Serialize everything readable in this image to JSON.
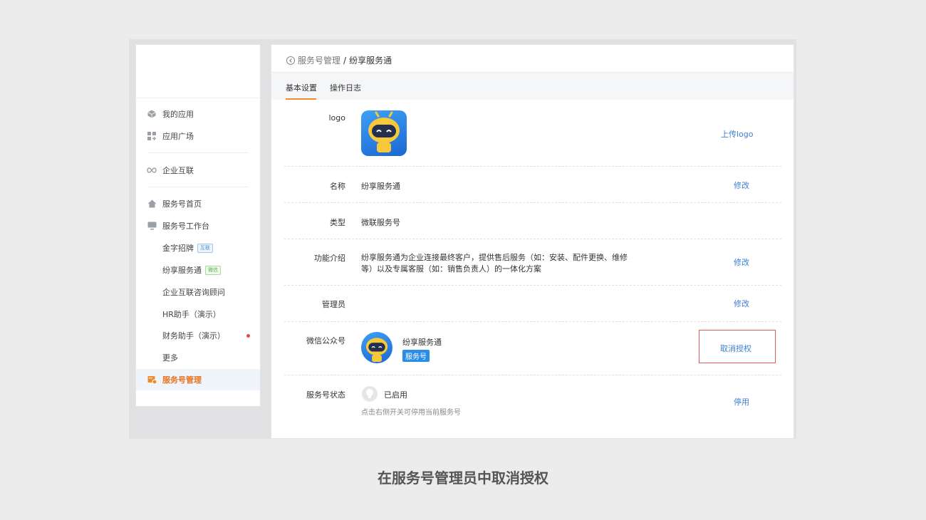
{
  "sidebar": {
    "items": [
      {
        "label": "我的应用",
        "icon": "cube-icon"
      },
      {
        "label": "应用广场",
        "icon": "apps-plus-icon"
      },
      {
        "label": "企业互联",
        "icon": "infinity-icon"
      },
      {
        "label": "服务号首页",
        "icon": "home-icon"
      },
      {
        "label": "服务号工作台",
        "icon": "monitor-icon"
      }
    ],
    "subitems": [
      {
        "label": "金字招牌",
        "tag": "互联"
      },
      {
        "label": "纷享服务通",
        "tag": "微信"
      },
      {
        "label": "企业互联咨询顾问"
      },
      {
        "label": "HR助手（演示）"
      },
      {
        "label": "财务助手（演示）"
      },
      {
        "label": "更多"
      }
    ],
    "active": {
      "label": "服务号管理",
      "icon": "service-manage-icon"
    }
  },
  "breadcrumb": {
    "parent": "服务号管理",
    "separator": "/",
    "current": "纷享服务通"
  },
  "tabs": [
    {
      "label": "基本设置"
    },
    {
      "label": "操作日志"
    }
  ],
  "rows": {
    "logo": {
      "label": "logo",
      "action": "上传logo"
    },
    "name": {
      "label": "名称",
      "value": "纷享服务通",
      "action": "修改"
    },
    "type": {
      "label": "类型",
      "value": "微联服务号"
    },
    "intro": {
      "label": "功能介绍",
      "value_line1": "纷享服务通为企业连接最终客户，提供售后服务（如：安装、配件更换、维修",
      "value_line2": "等）以及专属客服（如：销售负责人）的一体化方案",
      "action": "修改"
    },
    "admin": {
      "label": "管理员",
      "action": "修改"
    },
    "wechat": {
      "label": "微信公众号",
      "account": "纷享服务通",
      "badge": "服务号",
      "action": "取消授权"
    },
    "status": {
      "label": "服务号状态",
      "value": "已启用",
      "hint": "点击右侧开关可停用当前服务号",
      "action": "停用"
    }
  },
  "caption": "在服务号管理员中取消授权",
  "colors": {
    "accent": "#f08a2a",
    "link": "#3b7fd4",
    "highlight": "#e05a5a"
  }
}
